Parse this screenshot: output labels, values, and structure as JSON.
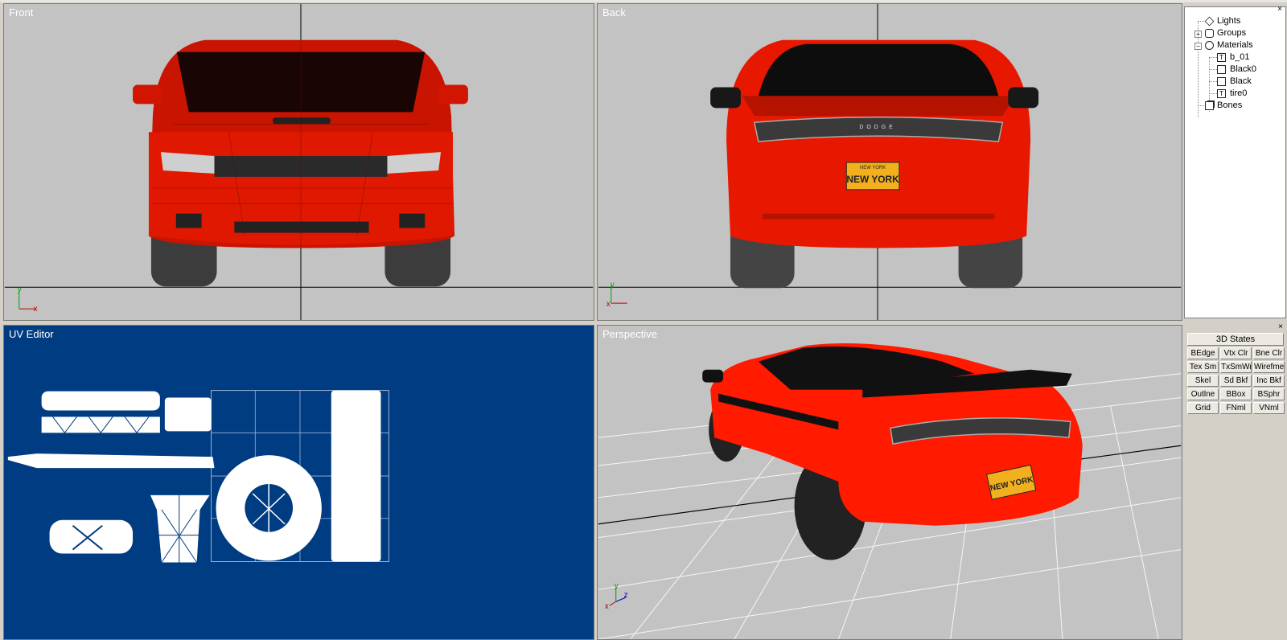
{
  "viewports": {
    "front": {
      "title": "Front"
    },
    "back": {
      "title": "Back"
    },
    "uv": {
      "title": "UV Editor"
    },
    "perspective": {
      "title": "Perspective"
    }
  },
  "axes": {
    "x": "x",
    "y": "y",
    "z": "z"
  },
  "plate": {
    "top": "NEW YORK",
    "main": "NEW YORK"
  },
  "badge": "DODGE",
  "scene_tree": {
    "items": [
      {
        "label": "Lights",
        "icon": "diamond-light-icon"
      },
      {
        "label": "Groups",
        "icon": "cylinder-group-icon",
        "expandable": true
      },
      {
        "label": "Materials",
        "icon": "sphere-material-icon",
        "expandable": true,
        "expanded": true
      },
      {
        "label": "b_01",
        "icon": "texture-material-icon",
        "child": true
      },
      {
        "label": "Black0",
        "icon": "plain-material-icon",
        "child": true
      },
      {
        "label": "Black",
        "icon": "plain-material-icon",
        "child": true
      },
      {
        "label": "tire0",
        "icon": "texture-material-icon",
        "child": true
      },
      {
        "label": "Bones",
        "icon": "bone-cube-icon"
      }
    ],
    "close": "×"
  },
  "states_panel": {
    "title": "3D States",
    "close": "×",
    "buttons": [
      "BEdge",
      "Vtx Clr",
      "Bne Clr",
      "Tex Sm",
      "TxSmWr",
      "Wirefme",
      "Skel",
      "Sd Bkf",
      "Inc Bkf",
      "Outlne",
      "BBox",
      "BSphr",
      "Grid",
      "FNml",
      "VNml"
    ]
  },
  "colors": {
    "viewport_bg": "#c3c3c3",
    "uv_bg": "#003c82",
    "car_red": "#ff1a00",
    "car_dark": "#1a1a1a",
    "plate_yellow": "#f2b01e"
  }
}
